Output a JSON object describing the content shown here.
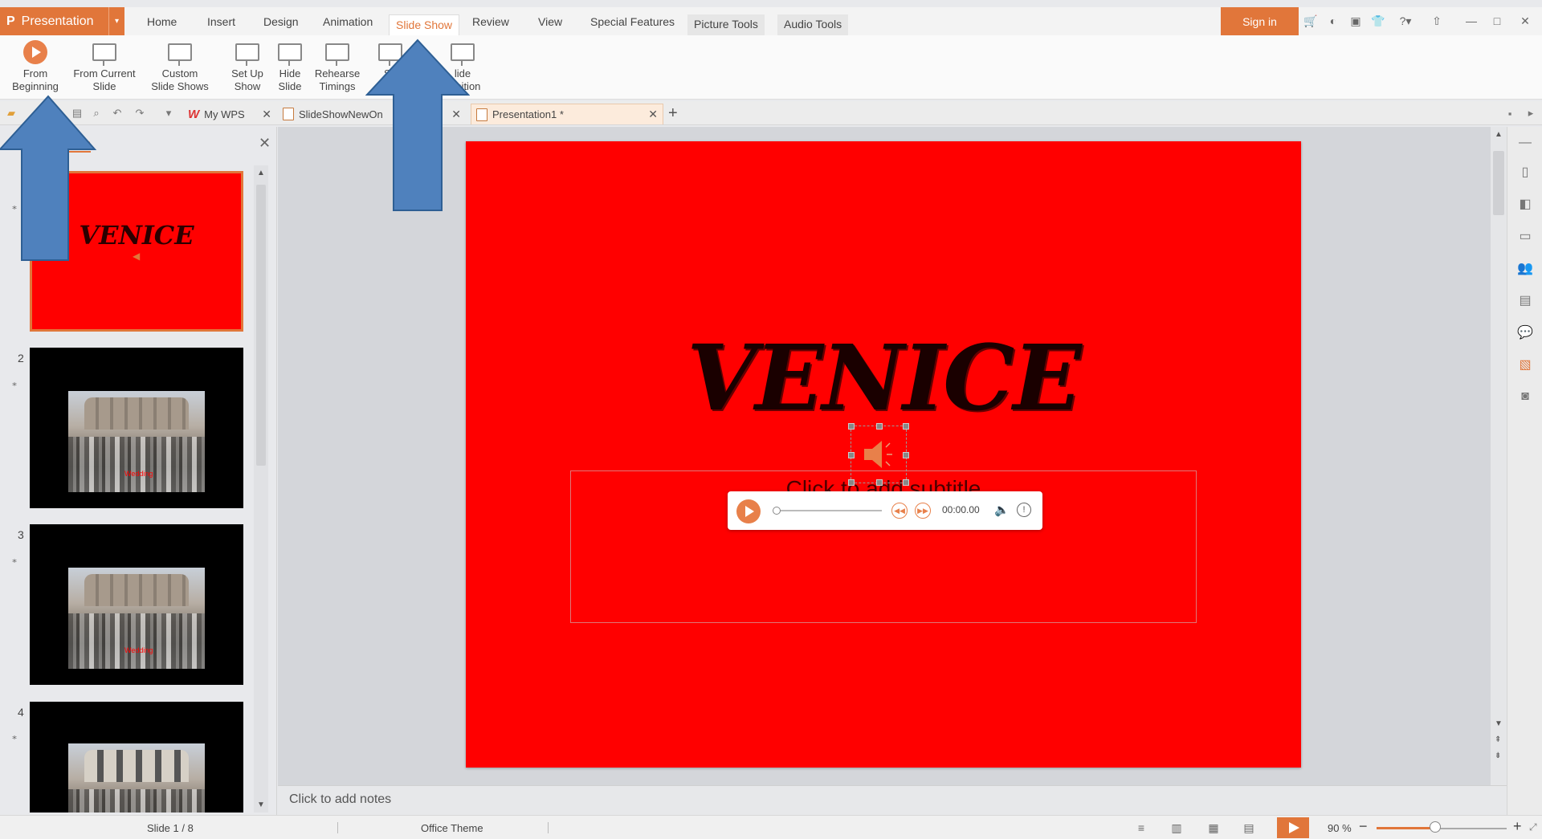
{
  "app": {
    "name": "Presentation",
    "logo": "P"
  },
  "menu": {
    "tabs": [
      "Home",
      "Insert",
      "Design",
      "Animation",
      "Slide Show",
      "Review",
      "View",
      "Special Features",
      "Picture Tools",
      "Audio Tools"
    ],
    "active_tab": "Slide Show",
    "sign_in": "Sign in"
  },
  "ribbon": {
    "from_beginning": [
      "From",
      "Beginning"
    ],
    "from_current": [
      "From Current",
      "Slide"
    ],
    "custom": [
      "Custom",
      "Slide Shows"
    ],
    "setup": [
      "Set Up",
      "Show"
    ],
    "hide": [
      "Hide",
      "Slide"
    ],
    "rehearse": [
      "Rehearse",
      "Timings"
    ],
    "speaker": [
      "Sp",
      "No"
    ],
    "transition": [
      "lide",
      "ansition"
    ]
  },
  "doc_tabs": {
    "my_wps": "My WPS",
    "slideshow": "SlideShowNewOn",
    "presentation": "Presentation1 *"
  },
  "panel": {
    "tab_outline": "O",
    "tab_slides": "lides",
    "slide_numbers": [
      "2",
      "3",
      "4"
    ],
    "thumb_title": "VENICE",
    "thumb_caption": "Wedding"
  },
  "slide": {
    "title": "VENICE",
    "subtitle_placeholder": "Click to add subtitle"
  },
  "player": {
    "time": "00:00.00"
  },
  "notes": {
    "placeholder": "Click to add notes"
  },
  "status": {
    "slide_indicator": "Slide 1 / 8",
    "theme": "Office Theme",
    "zoom": "90 %",
    "zoom_level": 0.45
  },
  "colors": {
    "accent": "#e1763a",
    "slide_bg": "#ff0000",
    "arrow": "#4f81bd"
  }
}
